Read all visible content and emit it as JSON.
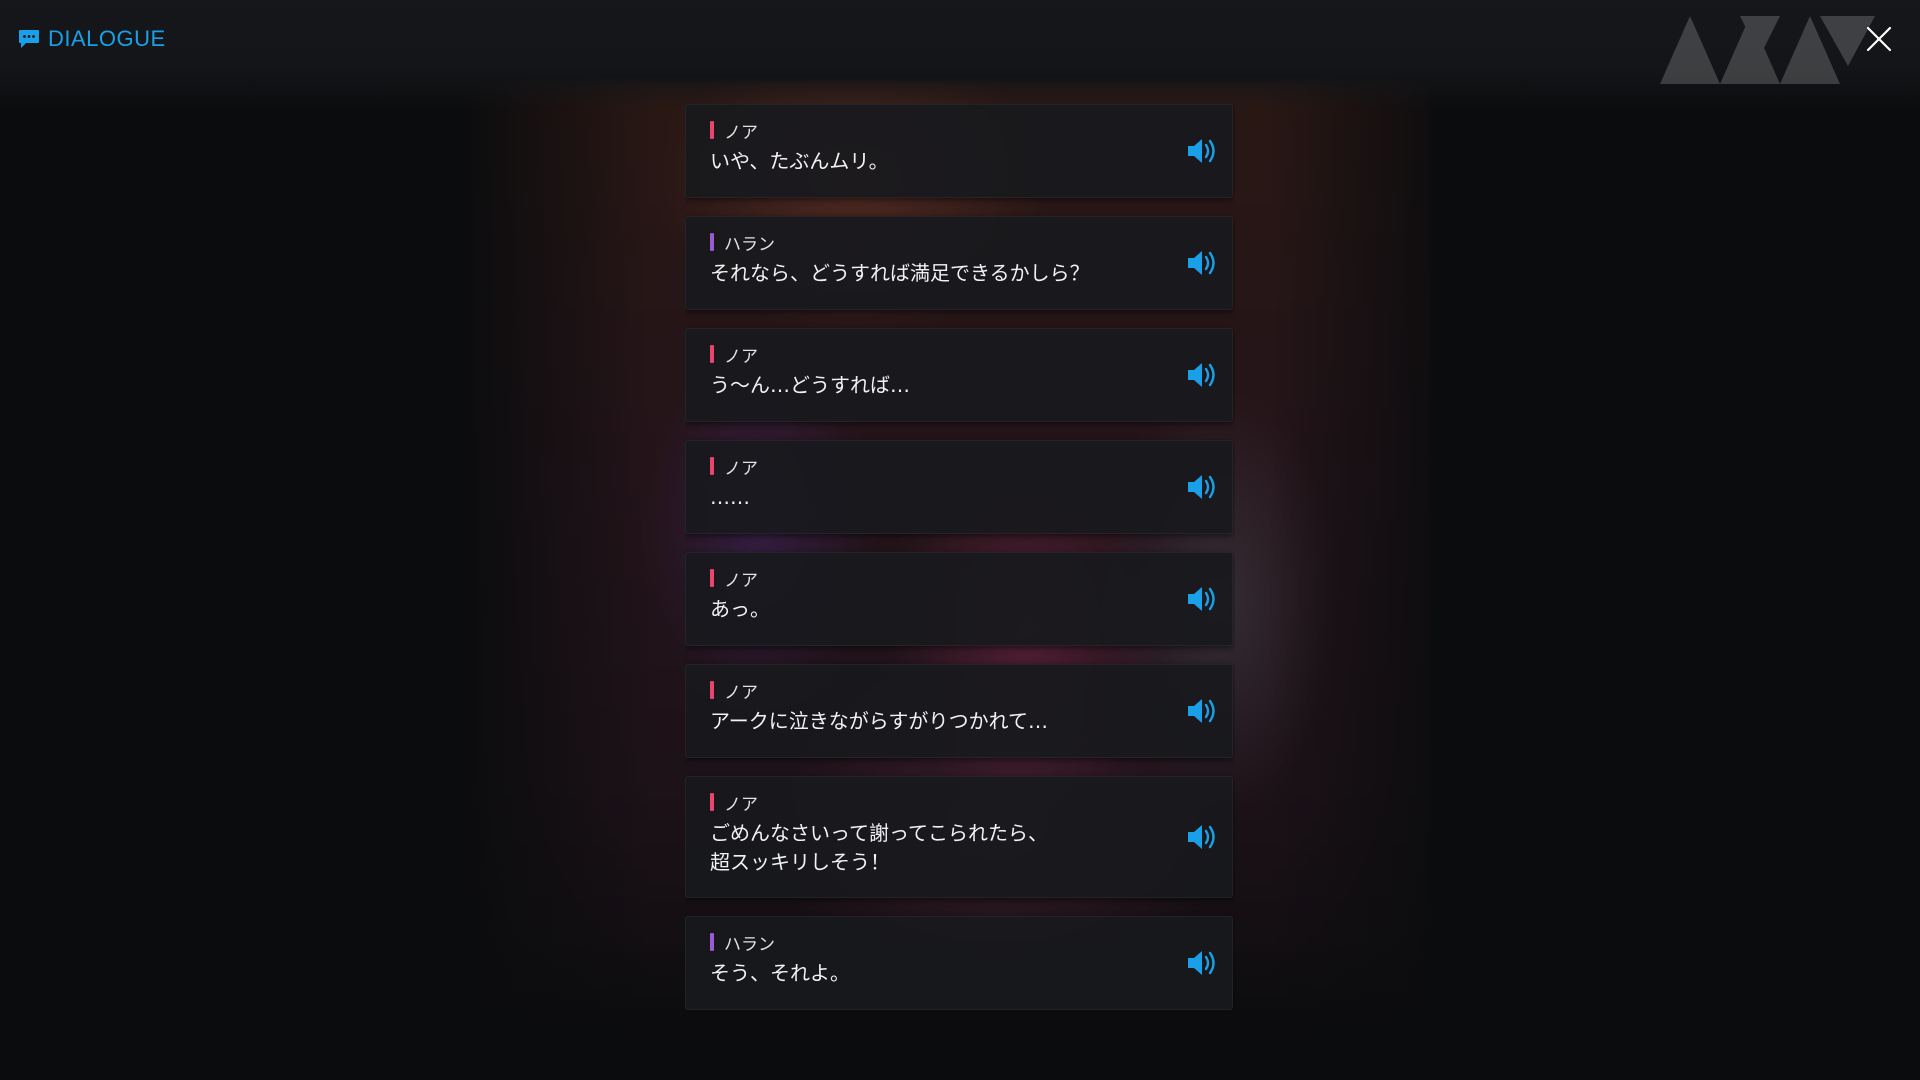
{
  "header": {
    "title": "DIALOGUE",
    "icon": "chat-bubble-icon",
    "close_icon": "close-icon"
  },
  "colors": {
    "accent": "#1aa0e8",
    "speaker_noa": "#e8466e",
    "speaker_haran": "#9b59d6",
    "card_bg": "#18191d"
  },
  "dialogue": [
    {
      "speaker": "ノア",
      "text": "いや、たぶんムリ。",
      "speaker_key": "noa"
    },
    {
      "speaker": "ハラン",
      "text": "それなら、どうすれば満足できるかしら？",
      "speaker_key": "haran"
    },
    {
      "speaker": "ノア",
      "text": "う～ん…どうすれば…",
      "speaker_key": "noa"
    },
    {
      "speaker": "ノア",
      "text": "……",
      "speaker_key": "noa"
    },
    {
      "speaker": "ノア",
      "text": "あっ。",
      "speaker_key": "noa"
    },
    {
      "speaker": "ノア",
      "text": "アークに泣きながらすがりつかれて…",
      "speaker_key": "noa"
    },
    {
      "speaker": "ノア",
      "text": "ごめんなさいって謝ってこられたら、\n超スッキリしそう！",
      "speaker_key": "noa"
    },
    {
      "speaker": "ハラン",
      "text": "そう、それよ。",
      "speaker_key": "haran"
    }
  ]
}
